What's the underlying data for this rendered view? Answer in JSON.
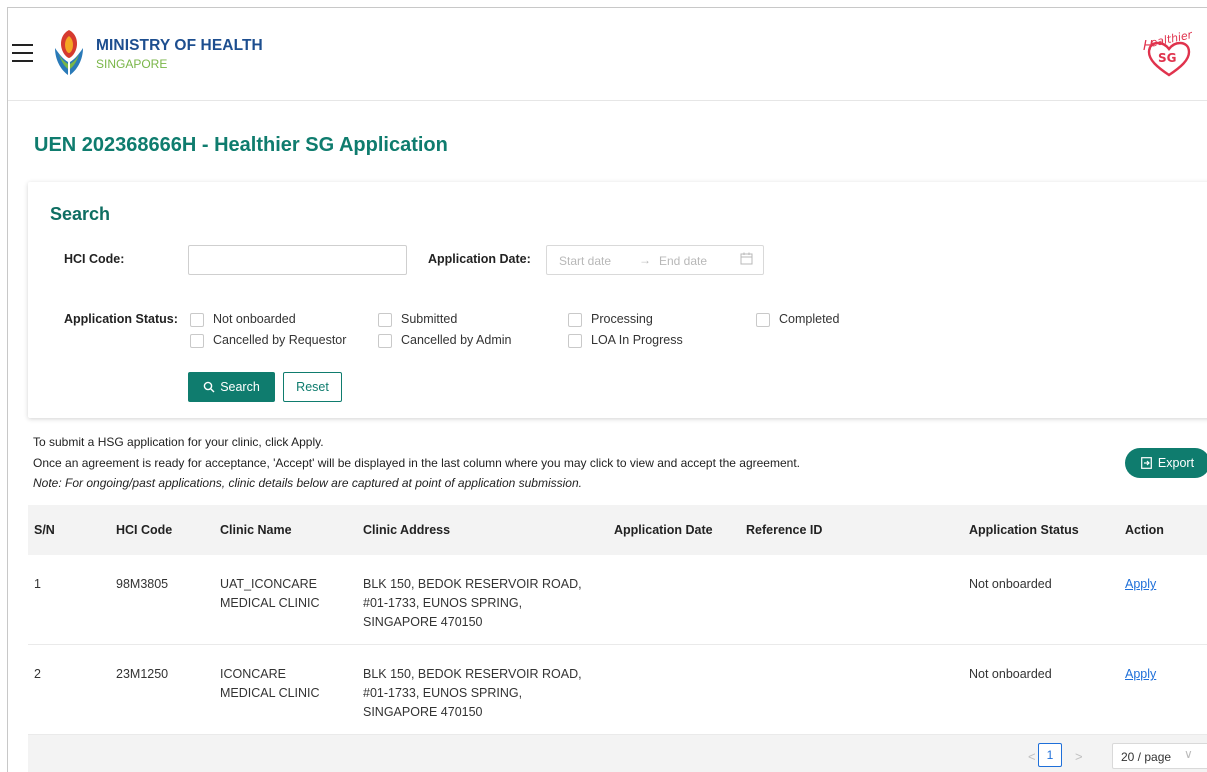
{
  "header": {
    "org_name": "MINISTRY OF HEALTH",
    "org_country": "SINGAPORE",
    "logo_right": "Healthier SG"
  },
  "page_title": "UEN 202368666H - Healthier SG Application",
  "search": {
    "heading": "Search",
    "hci_code_label": "HCI Code:",
    "hci_code_value": "",
    "app_date_label": "Application Date:",
    "start_placeholder": "Start date",
    "end_placeholder": "End date",
    "status_label": "Application Status:",
    "statuses": [
      "Not onboarded",
      "Submitted",
      "Processing",
      "Completed",
      "Cancelled by Requestor",
      "Cancelled by Admin",
      "LOA In Progress"
    ],
    "search_button": "Search",
    "reset_button": "Reset"
  },
  "info": {
    "line1": "To submit a HSG application for your clinic, click Apply.",
    "line2": "Once an agreement is ready for acceptance, 'Accept' will be displayed in the last column where you may click to view and accept the agreement.",
    "note": "Note: For ongoing/past applications, clinic details below are captured at point of application submission."
  },
  "export_button": "Export",
  "table": {
    "headers": [
      "S/N",
      "HCI Code",
      "Clinic Name",
      "Clinic Address",
      "Application Date",
      "Reference ID",
      "Application Status",
      "Action"
    ],
    "rows": [
      {
        "sn": "1",
        "hci": "98M3805",
        "name_l1": "UAT_ICONCARE",
        "name_l2": "MEDICAL CLINIC",
        "addr_l1": "BLK 150, BEDOK RESERVOIR ROAD,",
        "addr_l2": "#01-1733, EUNOS SPRING,",
        "addr_l3": "SINGAPORE 470150",
        "app_date": "",
        "ref_id": "",
        "status": "Not onboarded",
        "action": "Apply"
      },
      {
        "sn": "2",
        "hci": "23M1250",
        "name_l1": "ICONCARE",
        "name_l2": "MEDICAL CLINIC",
        "addr_l1": "BLK 150, BEDOK RESERVOIR ROAD,",
        "addr_l2": "#01-1733, EUNOS SPRING,",
        "addr_l3": "SINGAPORE 470150",
        "app_date": "",
        "ref_id": "",
        "status": "Not onboarded",
        "action": "Apply"
      }
    ]
  },
  "pagination": {
    "current_page": "1",
    "page_size": "20 / page"
  },
  "colors": {
    "brand_teal": "#0f7c6e",
    "link_blue": "#1e6fd9",
    "moh_blue": "#1d4e8f",
    "hsg_red": "#e0334d"
  }
}
